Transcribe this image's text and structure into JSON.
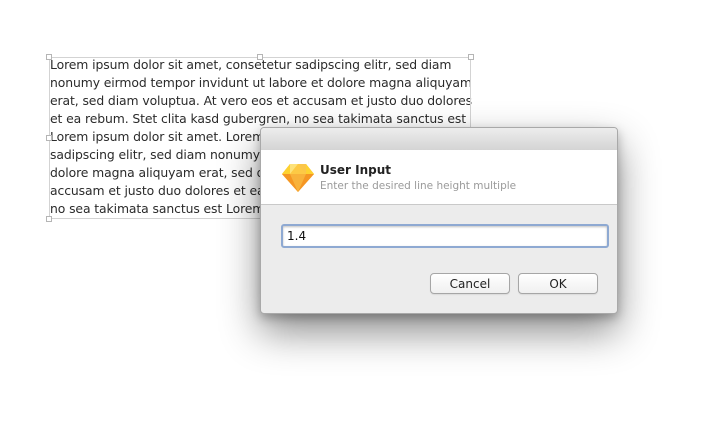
{
  "canvas": {
    "paragraph": "Lorem ipsum dolor sit amet, consetetur sadipscing elitr, sed diam\nnonumy eirmod tempor invidunt ut labore et dolore magna aliquyam\nerat, sed diam voluptua. At vero eos et accusam et justo duo dolores\net ea rebum. Stet clita kasd gubergren, no sea takimata sanctus est\nLorem ipsum dolor sit amet. Lorem\nsadipscing elitr, sed diam nonumy e\ndolore magna aliquyam erat, sed di\naccusam et justo duo dolores et ea\nno sea takimata sanctus est Lorem i"
  },
  "dialog": {
    "title": "User Input",
    "subtitle": "Enter the desired line height multiple",
    "app_icon": "sketch-diamond-icon",
    "input_value": "1.4",
    "cancel_label": "Cancel",
    "ok_label": "OK"
  },
  "colors": {
    "input_focus": "#8ea9d2",
    "icon_orange": "#f5a623",
    "icon_yellow": "#fdd231"
  }
}
